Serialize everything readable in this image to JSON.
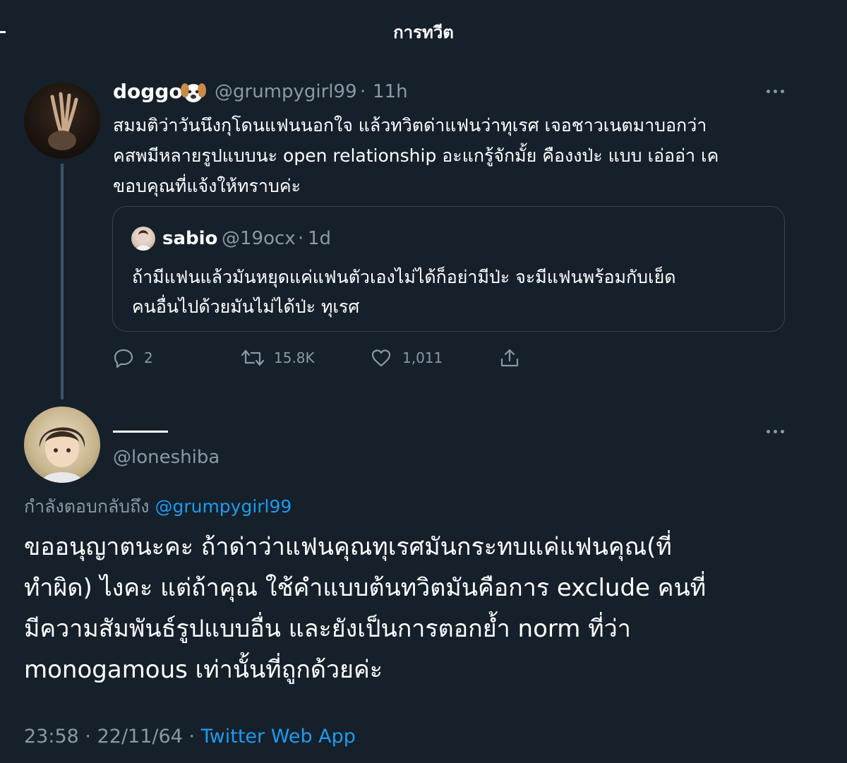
{
  "header": {
    "title": "การทวีต"
  },
  "tweet": {
    "name": "doggo",
    "name_emoji": "dog-face-emoji",
    "handle": "@grumpygirl99",
    "separator": "·",
    "time": "11h",
    "body": "สมมติว่าวันนึงกุโดนแฟนนอกใจ แล้วทวิตด่าแฟนว่าทุเรศ เจอชาวเนตมาบอกว่า\nคสพมีหลายรูปแบบนะ open relationship อะแกรู้จักมั้ย คืองงป่ะ แบบ เอ่ออ่า เค\nขอบคุณที่แจ้งให้ทราบค่ะ",
    "more_icon": "more-horizontal-icon",
    "quote": {
      "name": "sabio",
      "handle": "@19ocx",
      "separator": "·",
      "time": "1d",
      "body": "ถ้ามีแฟนแล้วมันหยุดแค่แฟนตัวเองไม่ได้ก็อย่ามีป่ะ จะมีแฟนพร้อมกับเย็ด\nคนอื่นไปด้วยมันไม่ได้ป่ะ ทุเรศ"
    },
    "actions": {
      "replies": "2",
      "retweets": "15.8K",
      "likes": "1,011"
    }
  },
  "reply": {
    "handle": "@loneshiba",
    "replying_to_label": "กำลังตอบกลับถึง",
    "replying_to_handle": "@grumpygirl99",
    "body": "ขออนุญาตนะคะ ถ้าด่าว่าแฟนคุณทุเรศมันกระทบแค่แฟนคุณ(ที่\nทำผิด) ไงคะ แต่ถ้าคุณ ใช้คำแบบต้นทวิตมันคือการ exclude คนที่\nมีความสัมพันธ์รูปแบบอื่น และยังเป็นการตอกย้ำ norm ที่ว่า\nmonogamous เท่านั้นที่ถูกด้วยค่ะ",
    "time": "23:58",
    "date": "22/11/64",
    "separator": "·",
    "source": "Twitter Web App"
  },
  "colors": {
    "background": "#15202b",
    "secondary_text": "#8b98a5",
    "link": "#1d9bf0",
    "border": "#38444d"
  }
}
